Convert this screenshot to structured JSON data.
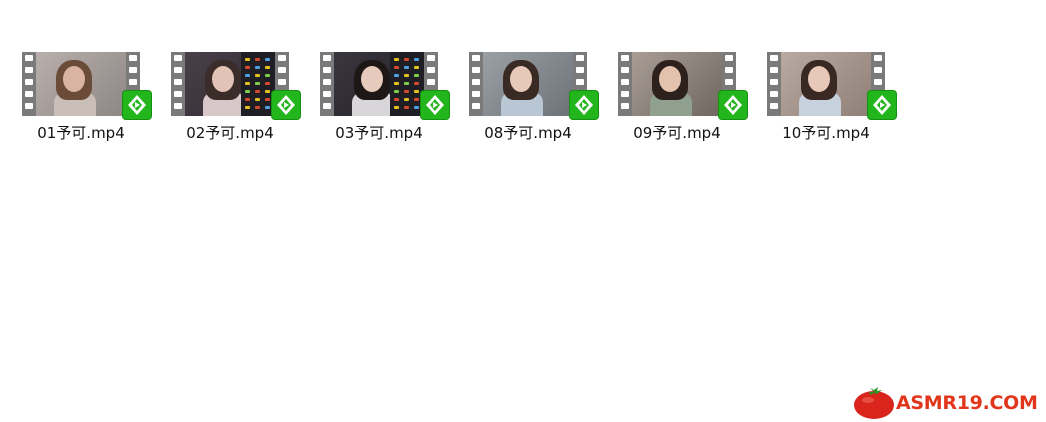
{
  "files": [
    {
      "name": "01予可.mp4",
      "scene": {
        "bg1": "#b9b0ad",
        "bg2": "#8d8684",
        "hair": "#6b4c38",
        "skin": "#d9b4a2",
        "cloth": "#c9bfb8",
        "ui": false
      }
    },
    {
      "name": "02予可.mp4",
      "scene": {
        "bg1": "#4a4048",
        "bg2": "#2e2a30",
        "hair": "#3a2c28",
        "skin": "#e3c3b5",
        "cloth": "#d8c7c9",
        "ui": true
      }
    },
    {
      "name": "03予可.mp4",
      "scene": {
        "bg1": "#3a3640",
        "bg2": "#242028",
        "hair": "#1d1716",
        "skin": "#e6cbbd",
        "cloth": "#d9d6da",
        "ui": true
      }
    },
    {
      "name": "08予可.mp4",
      "scene": {
        "bg1": "#9aa0a4",
        "bg2": "#6c7278",
        "hair": "#3a2a24",
        "skin": "#e8c9b9",
        "cloth": "#b9c7d4",
        "ui": false
      }
    },
    {
      "name": "09予可.mp4",
      "scene": {
        "bg1": "#a89e96",
        "bg2": "#6f6660",
        "hair": "#2c211d",
        "skin": "#e2c1ad",
        "cloth": "#8fa08f",
        "ui": false
      }
    },
    {
      "name": "10予可.mp4",
      "scene": {
        "bg1": "#b9aaa2",
        "bg2": "#8f7f77",
        "hair": "#3a2822",
        "skin": "#e6c7b8",
        "cloth": "#c7d0dd",
        "ui": false
      }
    }
  ],
  "badge_icon": "video-player-icon",
  "file_type_icon": "film-strip-icon",
  "watermark": {
    "text": "ASMR19.COM",
    "icon": "tomato-icon",
    "color": "#e2361c"
  },
  "colors": {
    "badge_green": "#23b51c",
    "film_strip": "#7a7a7a",
    "background": "#ffffff"
  }
}
